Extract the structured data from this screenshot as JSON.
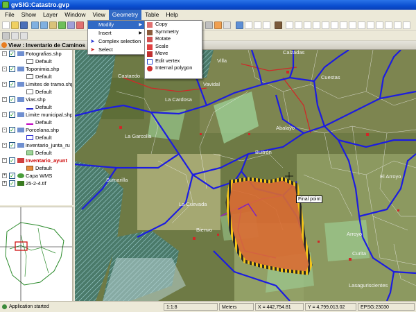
{
  "window": {
    "title": "gvSIG:Catastro.gvp"
  },
  "menubar": {
    "items": [
      {
        "label": "File"
      },
      {
        "label": "Show"
      },
      {
        "label": "Layer"
      },
      {
        "label": "Window"
      },
      {
        "label": "View"
      },
      {
        "label": "Geometry"
      },
      {
        "label": "Table"
      },
      {
        "label": "Help"
      }
    ],
    "active": "Geometry"
  },
  "geometry_menu": {
    "items": [
      {
        "label": "Modify",
        "has_submenu": true,
        "highlighted": true
      },
      {
        "label": "Insert",
        "has_submenu": true
      },
      {
        "label": "Complex selection"
      },
      {
        "label": "Select"
      }
    ]
  },
  "modify_submenu": {
    "items": [
      {
        "label": "Copy",
        "icon": "copy-icon"
      },
      {
        "label": "Symmetry",
        "icon": "symmetry-icon"
      },
      {
        "label": "Rotate",
        "icon": "rotate-icon"
      },
      {
        "label": "Scale",
        "icon": "scale-icon"
      },
      {
        "label": "Move",
        "icon": "move-icon"
      },
      {
        "label": "Edit vertex",
        "icon": "edit-vertex-icon"
      },
      {
        "label": "Internal polygon",
        "icon": "internal-polygon-icon"
      }
    ]
  },
  "view": {
    "title": "View : Inventario de Caminos"
  },
  "toc": {
    "layers": [
      {
        "name": "Fotografias.shp",
        "legend": "Default",
        "color": "#2a2ad0"
      },
      {
        "name": "Toponimia.shp",
        "legend": "Default",
        "color": "#2a2ad0"
      },
      {
        "name": "Limites de tramo.shp",
        "legend": "Default",
        "color": "#2a2ad0"
      },
      {
        "name": "Vias.shp",
        "legend": "Default",
        "color": "#2a2ad0"
      },
      {
        "name": "Limite municipal.shp",
        "legend": "Default",
        "color": "#c000c0"
      },
      {
        "name": "Porcelana.shp",
        "legend": "Default",
        "color": "#2a2ad0"
      },
      {
        "name": "inventario_junta_ru",
        "legend": "Default",
        "color": "#9fd49a"
      },
      {
        "name": "Inventario_ayunt",
        "legend": "Default",
        "color": "#e58a3a",
        "selected": true
      },
      {
        "name": "Capa WMS",
        "legend": "",
        "color": "#4a9d3a"
      },
      {
        "name": "25-2-4.tif",
        "legend": "",
        "color": "#3a7a20"
      }
    ]
  },
  "map": {
    "labels": [
      "Castaedo",
      "Villa",
      "Vavidal",
      "La Garcolla",
      "Cuestas",
      "La Cardosa",
      "Buitrón",
      "Bienvo",
      "Arroyo",
      "Curita",
      "Sumarilla",
      "Abalayo",
      "Calzadas",
      "El Arroyo",
      "La Cuevada",
      "Lasaguriscientes"
    ],
    "tooltip": "Final point"
  },
  "statusbar": {
    "message": "Application started",
    "scale": "1:1:8",
    "units": "Meters",
    "x": "X = 442,754.81",
    "y": "Y = 4,799,013.02",
    "crs": "EPSG:23030"
  }
}
